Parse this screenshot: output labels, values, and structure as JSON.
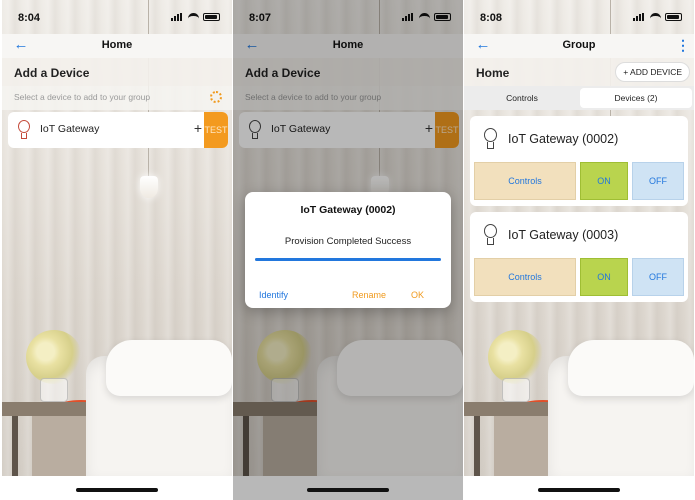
{
  "screens": [
    {
      "status": {
        "time": "8:04"
      },
      "nav": {
        "title": "Home"
      },
      "section_title": "Add a Device",
      "hint": "Select a device to add to your group",
      "device": {
        "name": "IoT Gateway",
        "add_symbol": "+",
        "test_label": "TEST"
      }
    },
    {
      "status": {
        "time": "8:07"
      },
      "nav": {
        "title": "Home"
      },
      "section_title": "Add a Device",
      "hint": "Select a device to add to your group",
      "device": {
        "name": "IoT Gateway",
        "add_symbol": "+",
        "test_label": "TEST"
      },
      "dialog": {
        "title": "IoT Gateway (0002)",
        "message": "Provision Completed Success",
        "progress": 1.0,
        "identify_label": "Identify",
        "rename_label": "Rename",
        "ok_label": "OK"
      }
    },
    {
      "status": {
        "time": "8:08"
      },
      "nav": {
        "title": "Group"
      },
      "section_title": "Home",
      "add_device_label": "+ ADD DEVICE",
      "tabs": [
        {
          "label": "Controls",
          "selected": false
        },
        {
          "label": "Devices (2)",
          "selected": true
        }
      ],
      "devices": [
        {
          "name": "IoT Gateway (0002)",
          "controls_label": "Controls",
          "on_label": "ON",
          "off_label": "OFF"
        },
        {
          "name": "IoT Gateway (0003)",
          "controls_label": "Controls",
          "on_label": "ON",
          "off_label": "OFF"
        }
      ]
    }
  ],
  "icons": {
    "back": "back-arrow-icon",
    "menu": "kebab-menu-icon",
    "bulb": "lightbulb-icon",
    "spinner": "loading-spinner-icon"
  },
  "colors": {
    "accent_blue": "#2277dd",
    "accent_orange": "#f39a1f",
    "on_green": "#b9d44e",
    "off_blue": "#cfe3f4",
    "controls_beige": "#f2e0bd"
  }
}
